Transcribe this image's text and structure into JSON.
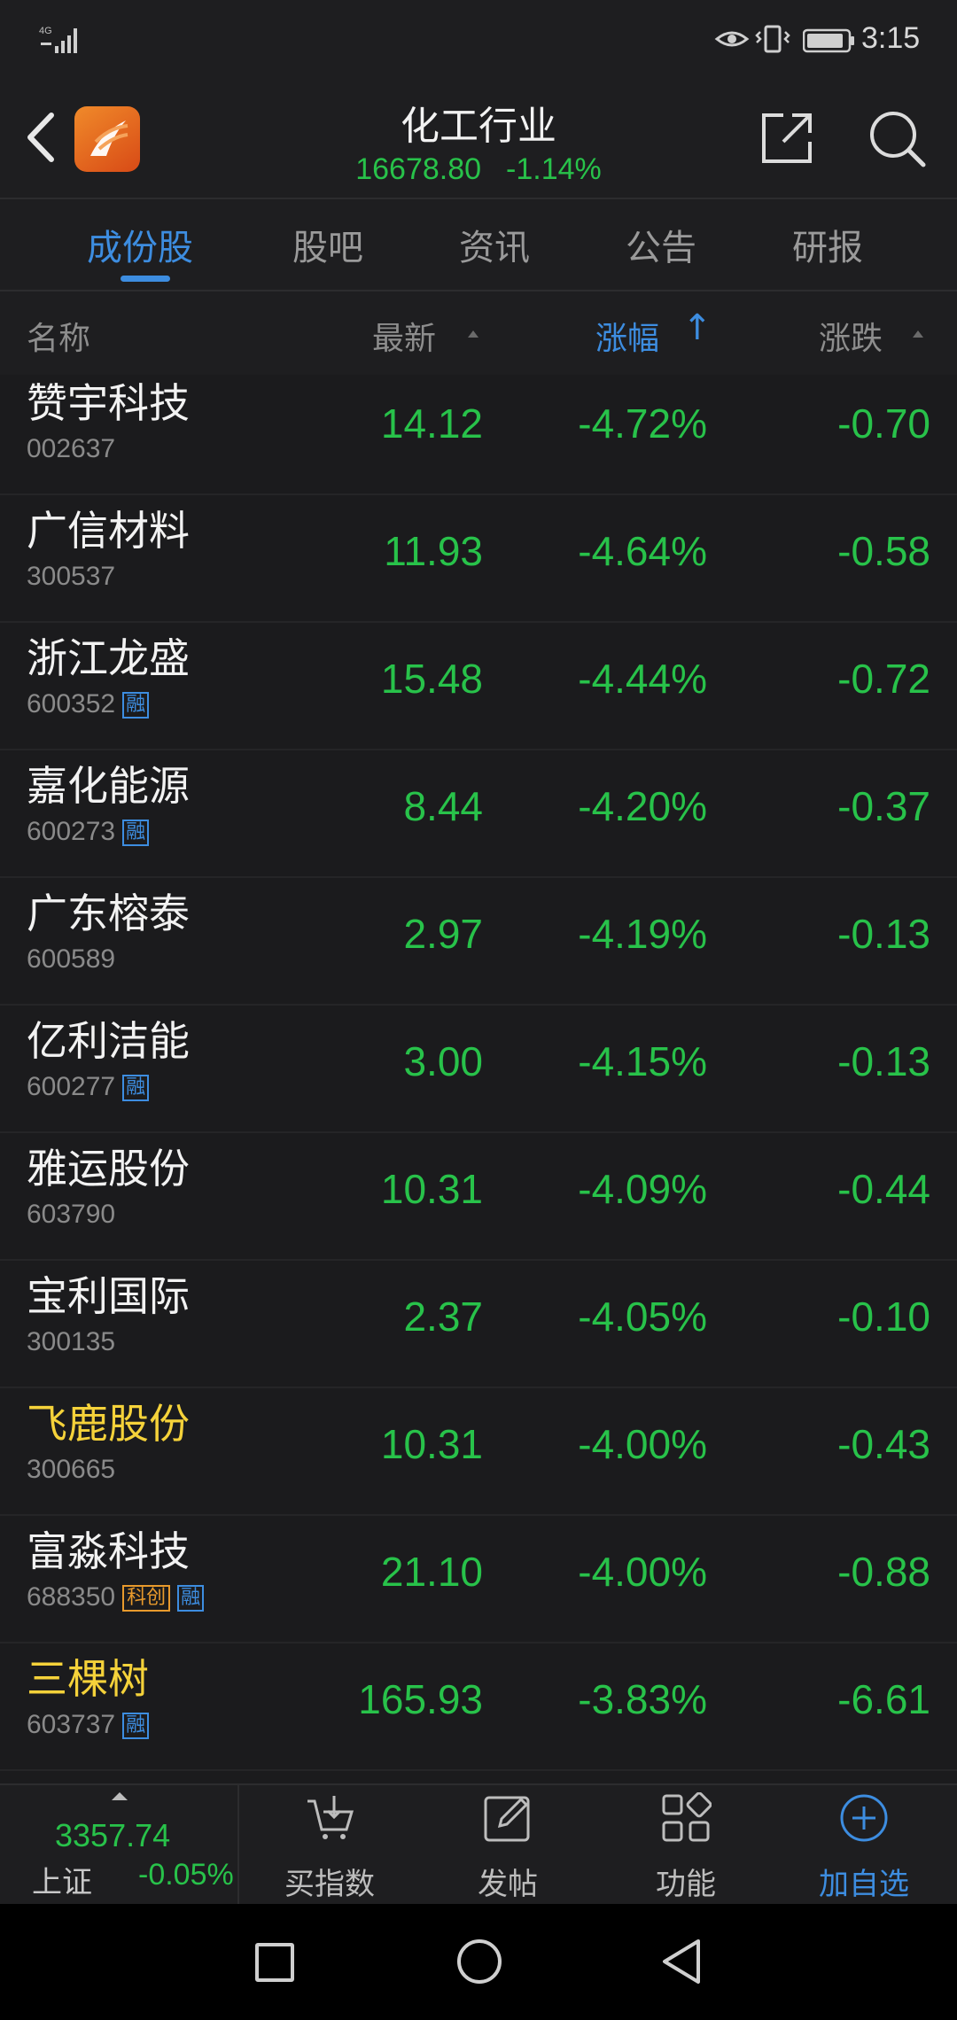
{
  "status_bar": {
    "network": "4G",
    "time": "3:15"
  },
  "header": {
    "title": "化工行业",
    "index_value": "16678.80",
    "index_change_pct": "-1.14%",
    "icons": [
      "back-icon",
      "app-logo",
      "share-icon",
      "search-icon"
    ]
  },
  "tabs": [
    {
      "label": "成份股",
      "active": true
    },
    {
      "label": "股吧",
      "active": false
    },
    {
      "label": "资讯",
      "active": false
    },
    {
      "label": "公告",
      "active": false
    },
    {
      "label": "研报",
      "active": false
    }
  ],
  "columns": {
    "name": "名称",
    "latest": "最新",
    "change_pct": "涨幅",
    "change": "涨跌",
    "sort_arrow": "↑"
  },
  "rows": [
    {
      "name": "赞宇科技",
      "code": "002637",
      "badges": [],
      "price": "14.12",
      "pct": "-4.72%",
      "chg": "-0.70",
      "highlight": false
    },
    {
      "name": "广信材料",
      "code": "300537",
      "badges": [],
      "price": "11.93",
      "pct": "-4.64%",
      "chg": "-0.58",
      "highlight": false
    },
    {
      "name": "浙江龙盛",
      "code": "600352",
      "badges": [
        "融"
      ],
      "price": "15.48",
      "pct": "-4.44%",
      "chg": "-0.72",
      "highlight": false
    },
    {
      "name": "嘉化能源",
      "code": "600273",
      "badges": [
        "融"
      ],
      "price": "8.44",
      "pct": "-4.20%",
      "chg": "-0.37",
      "highlight": false
    },
    {
      "name": "广东榕泰",
      "code": "600589",
      "badges": [],
      "price": "2.97",
      "pct": "-4.19%",
      "chg": "-0.13",
      "highlight": false
    },
    {
      "name": "亿利洁能",
      "code": "600277",
      "badges": [
        "融"
      ],
      "price": "3.00",
      "pct": "-4.15%",
      "chg": "-0.13",
      "highlight": false
    },
    {
      "name": "雅运股份",
      "code": "603790",
      "badges": [],
      "price": "10.31",
      "pct": "-4.09%",
      "chg": "-0.44",
      "highlight": false
    },
    {
      "name": "宝利国际",
      "code": "300135",
      "badges": [],
      "price": "2.37",
      "pct": "-4.05%",
      "chg": "-0.10",
      "highlight": false
    },
    {
      "name": "飞鹿股份",
      "code": "300665",
      "badges": [],
      "price": "10.31",
      "pct": "-4.00%",
      "chg": "-0.43",
      "highlight": true
    },
    {
      "name": "富淼科技",
      "code": "688350",
      "badges": [
        "科创",
        "融"
      ],
      "price": "21.10",
      "pct": "-4.00%",
      "chg": "-0.88",
      "highlight": false
    },
    {
      "name": "三棵树",
      "code": "603737",
      "badges": [
        "融"
      ],
      "price": "165.93",
      "pct": "-3.83%",
      "chg": "-6.61",
      "highlight": true
    }
  ],
  "bottom_bar": {
    "index_value": "3357.74",
    "index_name": "上证",
    "index_change": "-0.05%",
    "buttons": [
      {
        "label": "买指数",
        "icon": "buy-index-icon"
      },
      {
        "label": "发帖",
        "icon": "post-icon"
      },
      {
        "label": "功能",
        "icon": "grid-icon"
      },
      {
        "label": "加自选",
        "icon": "add-circle-icon"
      }
    ]
  },
  "colors": {
    "background": "#1b1b1d",
    "down_green": "#28c24a",
    "accent_blue": "#3d8de0",
    "highlight_yellow": "#f5d23a",
    "badge_orange": "#e89a2c"
  }
}
